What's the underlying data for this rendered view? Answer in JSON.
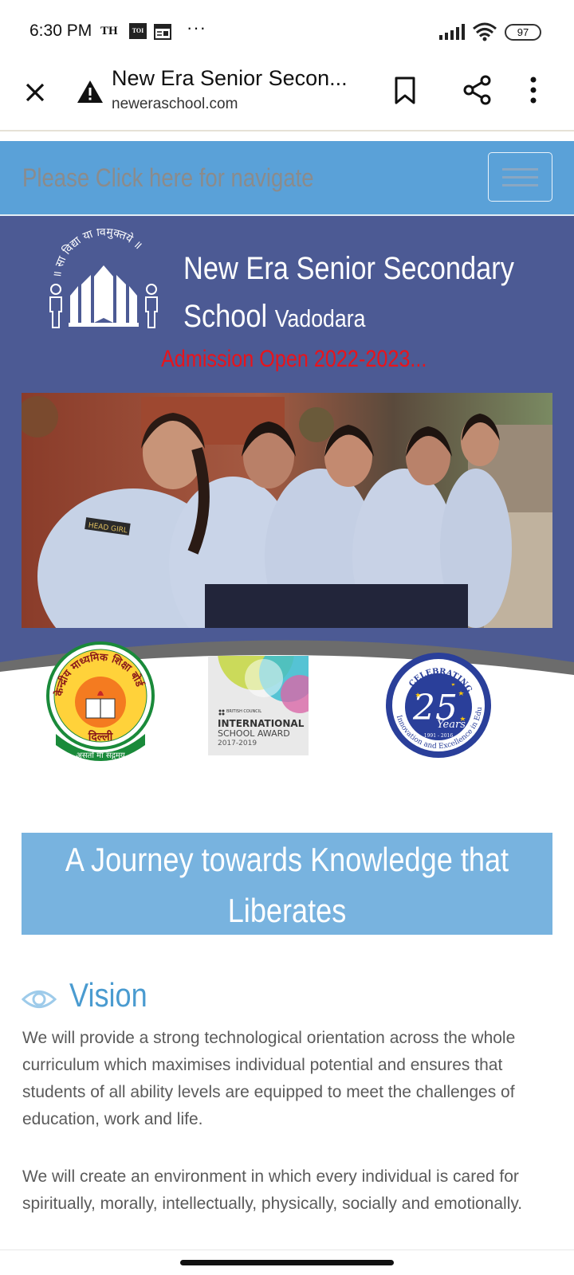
{
  "status_bar": {
    "time": "6:30 PM",
    "th_label": "TH",
    "toi_label": "TOI",
    "more": "···",
    "battery": "97"
  },
  "browser": {
    "page_title": "New Era Senior Secon...",
    "url": "neweraschool.com"
  },
  "nav": {
    "label": "Please Click here for navigate"
  },
  "hero": {
    "school_name_line1": "New Era Senior Secondary",
    "school_name_line2": "School",
    "school_city": "Vadodara",
    "admission": "Admission Open 2022-2023...",
    "photo_badge_text": "HEAD GIRL",
    "logo_motto": "॥ सा विद्या या विमुक्तये ॥"
  },
  "badges": {
    "cbse_top": "केन्द्रीय माध्यमिक शिक्षा बोर्ड",
    "cbse_city": "दिल्ली",
    "cbse_motto": "असतो मा सद्गमय",
    "british_council": "BRITISH COUNCIL",
    "intl_line1": "INTERNATIONAL",
    "intl_line2": "SCHOOL AWARD",
    "intl_years": "2017-2019",
    "anniv_top": "CELEBRATING",
    "anniv_number": "25",
    "anniv_word": "Years",
    "anniv_years": "1991 - 2016",
    "anniv_ring": "Innovation and Excellence in Education"
  },
  "journey": {
    "line1": "A Journey towards Knowledge that",
    "line2": "Liberates"
  },
  "vision": {
    "title": "Vision",
    "para1": "We will provide a strong technological orientation across the whole curriculum which maximises individual potential and ensures that students of all ability levels are equipped to meet the challenges of education, work and life.",
    "para2": "We will create an environment in which every individual is cared for spiritually, morally, intellectually, physically, socially and emotionally."
  },
  "colors": {
    "nav_blue": "#5aa1d8",
    "hero_navy": "#4c5a94",
    "admission_red": "#e8141b",
    "journey_blue": "#78b3df",
    "vision_blue": "#4a9bd0"
  }
}
